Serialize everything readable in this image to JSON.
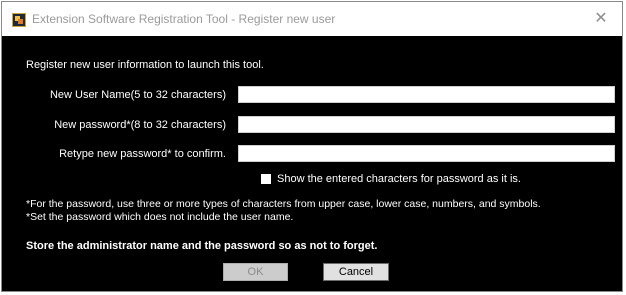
{
  "window": {
    "title": "Extension Software Registration Tool - Register new user",
    "close_glyph": "✕",
    "app_icon": "app-icon"
  },
  "intro": "Register new user information to launch this tool.",
  "fields": {
    "username": {
      "label": "New User Name(5 to 32 characters)",
      "value": ""
    },
    "password": {
      "label": "New password*(8 to 32 characters)",
      "value": ""
    },
    "retype": {
      "label": "Retype new password* to confirm.",
      "value": ""
    }
  },
  "show_password": {
    "label": "Show the entered characters for password as it is.",
    "checked": false
  },
  "notes": [
    "*For the password, use three or more types of characters from upper case, lower case, numbers, and symbols.",
    "*Set the password which does not include the user name."
  ],
  "warning": "Store the administrator name and the password so as not to forget.",
  "buttons": {
    "ok": "OK",
    "cancel": "Cancel"
  },
  "colors": {
    "background": "#000000",
    "titlebar": "#ffffff",
    "text": "#ffffff"
  }
}
